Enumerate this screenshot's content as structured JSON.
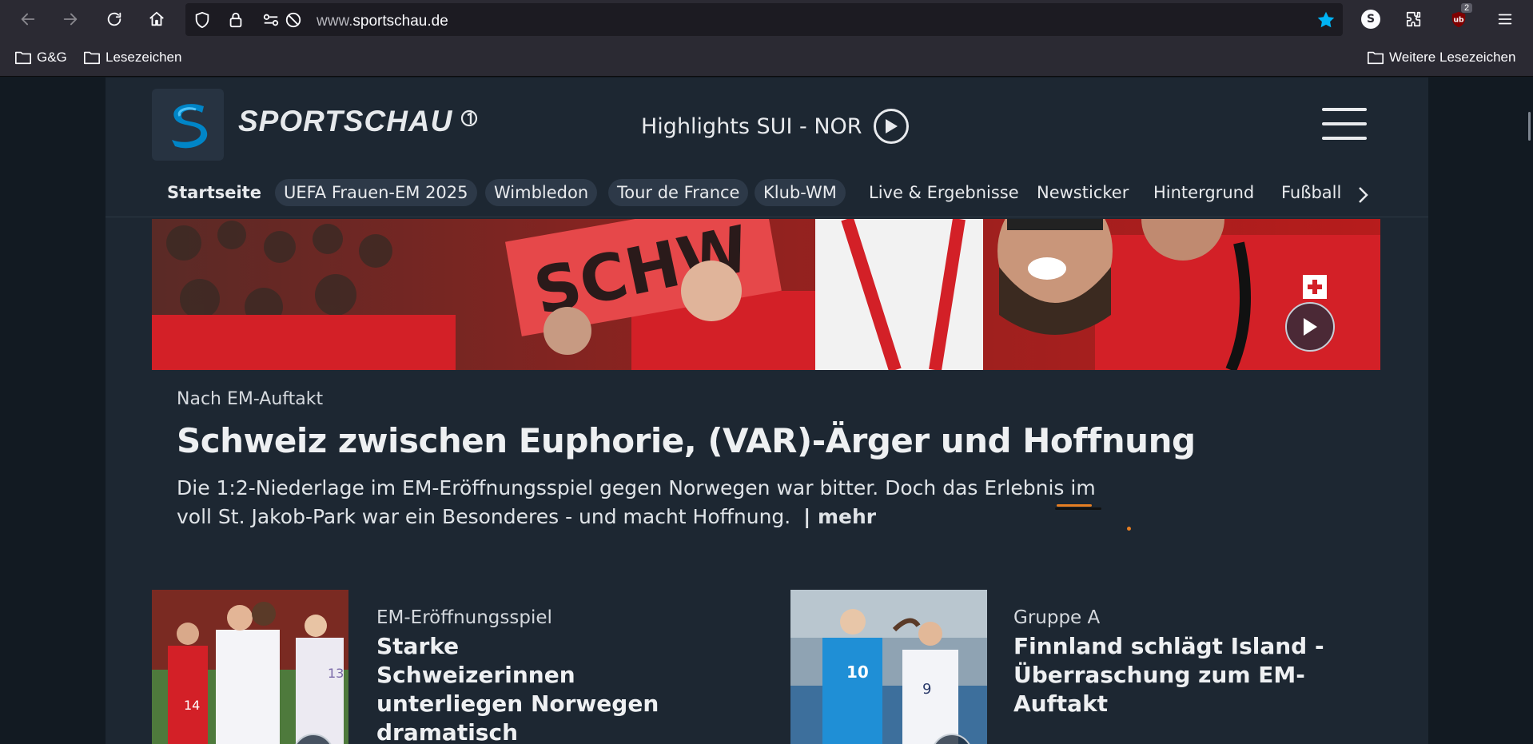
{
  "browser": {
    "url_prefix": "www.",
    "url_domain": "sportschau.de",
    "extension_badge": "2",
    "profile_letter": "S",
    "bookmarks": [
      {
        "label": "G&G"
      },
      {
        "label": "Lesezeichen"
      }
    ],
    "more_bookmarks": "Weitere Lesezeichen"
  },
  "site": {
    "brand": "SPORTSCHAU",
    "highlight": "Highlights SUI - NOR",
    "nav": [
      {
        "label": "Startseite"
      },
      {
        "label": "UEFA Frauen-EM 2025"
      },
      {
        "label": "Wimbledon"
      },
      {
        "label": "Tour de France"
      },
      {
        "label": "Klub-WM"
      },
      {
        "label": "Live & Ergebnisse"
      },
      {
        "label": "Newsticker"
      },
      {
        "label": "Hintergrund"
      },
      {
        "label": "Fußball"
      }
    ]
  },
  "lead": {
    "kicker": "Nach EM-Auftakt",
    "headline": "Schweiz zwischen Euphorie, (VAR)-Ärger und Hoffnung",
    "teaser": "Die 1:2-Niederlage im EM-Eröffnungsspiel gegen Norwegen war bitter. Doch das Erlebnis im voll St. Jakob-Park war ein Besonderes - und macht Hoffnung.",
    "more": "| mehr"
  },
  "cards": [
    {
      "kicker": "EM-Eröffnungsspiel",
      "title": "Starke Schweizerinnen unterliegen Norwegen dramatisch"
    },
    {
      "kicker": "Gruppe A",
      "title": "Finnland schlägt Island - Überraschung zum EM-Auftakt"
    }
  ],
  "colors": {
    "chrome": "#2b2a33",
    "page_bg": "#1d2732",
    "accent_star": "#00b3f4",
    "swiss_red": "#d32027"
  }
}
